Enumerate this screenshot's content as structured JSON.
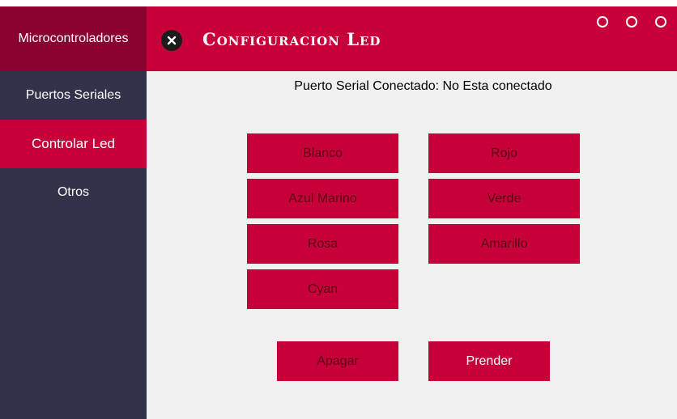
{
  "sidebar": {
    "brand": "Microcontroladores",
    "items": [
      {
        "label": "Puertos Seriales"
      },
      {
        "label": "Controlar Led"
      },
      {
        "label": "Otros"
      }
    ]
  },
  "header": {
    "title": "Configuracion Led"
  },
  "status": {
    "text": "Puerto Serial Conectado: No Esta conectado"
  },
  "colors": {
    "left": [
      "Blanco",
      "Azul Marino",
      "Rosa",
      "Cyan"
    ],
    "right": [
      "Rojo",
      "Verde",
      "Amarillo"
    ]
  },
  "actions": {
    "off_label": "Apagar",
    "on_label": "Prender"
  },
  "theme": {
    "accent": "#c8003a",
    "brand_dark": "#8a0330",
    "sidebar": "#32334a",
    "content_bg": "#f0f0f0"
  }
}
